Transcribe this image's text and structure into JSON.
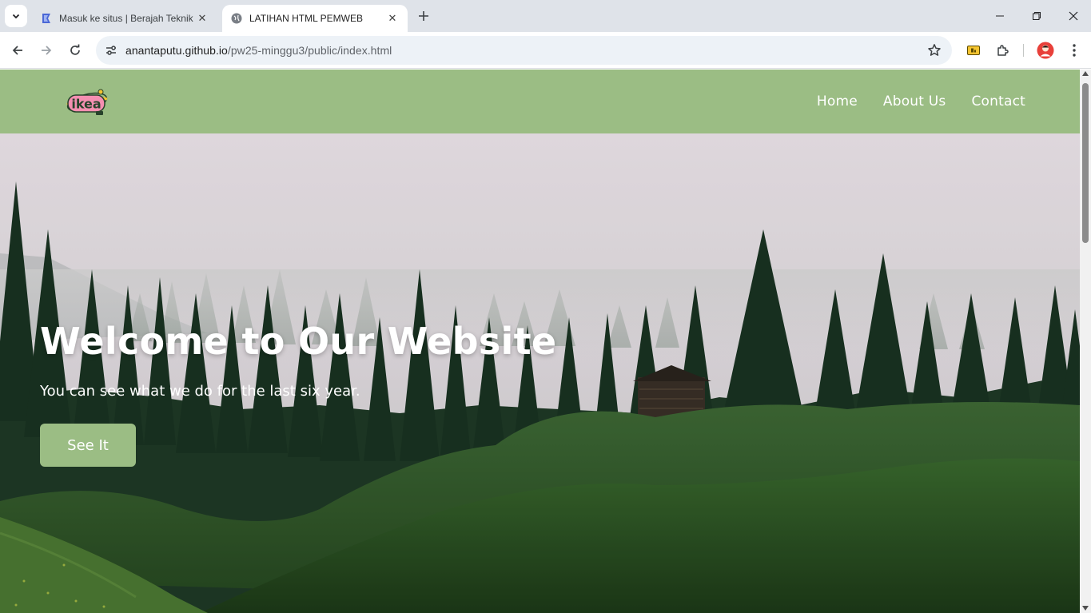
{
  "browser": {
    "tabs": [
      {
        "title": "Masuk ke situs | Berajah Teknik",
        "active": false,
        "favicon": "site-logo-icon"
      },
      {
        "title": "LATIHAN HTML PEMWEB",
        "active": true,
        "favicon": "globe-icon"
      }
    ],
    "url_host": "anantaputu.github.io",
    "url_path": "/pw25-minggu3/public/index.html"
  },
  "site": {
    "logo_text": "ikea",
    "nav": [
      "Home",
      "About Us",
      "Contact"
    ],
    "hero": {
      "title": "Welcome to Our Website",
      "subtitle": "You can see what we do for the last six year.",
      "button": "See It"
    }
  },
  "colors": {
    "brand_green": "#9bbd84",
    "chrome_bg": "#dfe3e9",
    "omnibox_bg": "#edf2f7"
  }
}
